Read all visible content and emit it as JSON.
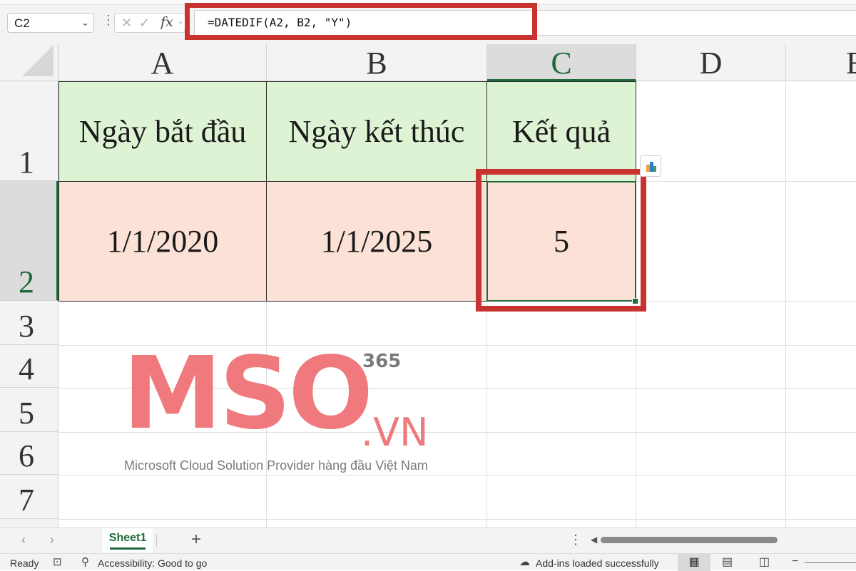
{
  "formula_bar": {
    "name_box": "C2",
    "kebab": "⋮",
    "fx": "fx",
    "formula": "=DATEDIF(A2, B2, \"Y\")",
    "highlight_color": "#c8322f"
  },
  "grid": {
    "columns": [
      "A",
      "B",
      "C",
      "D",
      "E"
    ],
    "rows": [
      "1",
      "2",
      "3",
      "4",
      "5",
      "6",
      "7"
    ],
    "selected_cell": "C2",
    "cells": {
      "A1": "Ngày bắt đầu",
      "B1": "Ngày kết thúc",
      "C1": "Kết quả",
      "A2": "1/1/2020",
      "B2": "1/1/2025",
      "C2": "5"
    },
    "header_fill": "#ddf3d4",
    "data_fill": "#fbe1d6",
    "selection_color": "#1f6b3c"
  },
  "watermark": {
    "word": "MSO",
    "number": "365",
    "domain": ".VN",
    "tagline": "Microsoft Cloud Solution Provider hàng đầu Việt Nam",
    "color": "#ee6b6e"
  },
  "sheet_tabs": {
    "active": "Sheet1",
    "add": "+"
  },
  "status_bar": {
    "ready": "Ready",
    "accessibility": "Accessibility: Good to go",
    "addins": "Add-ins loaded successfully"
  }
}
